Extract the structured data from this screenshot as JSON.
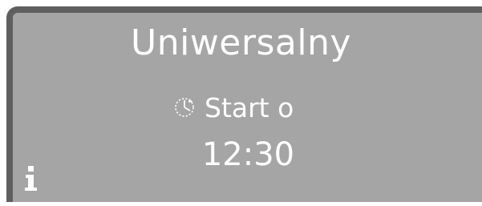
{
  "display": {
    "program_name": "Uniwersalny",
    "start_label": "Start o",
    "start_time": "12:30"
  },
  "icons": {
    "clock": "delay-start-clock-icon",
    "info": "info-icon"
  },
  "colors": {
    "screen_background": "#a5a5a5",
    "screen_border": "#5f5f5f",
    "text": "#ffffff",
    "info_icon": "#ffffff"
  }
}
